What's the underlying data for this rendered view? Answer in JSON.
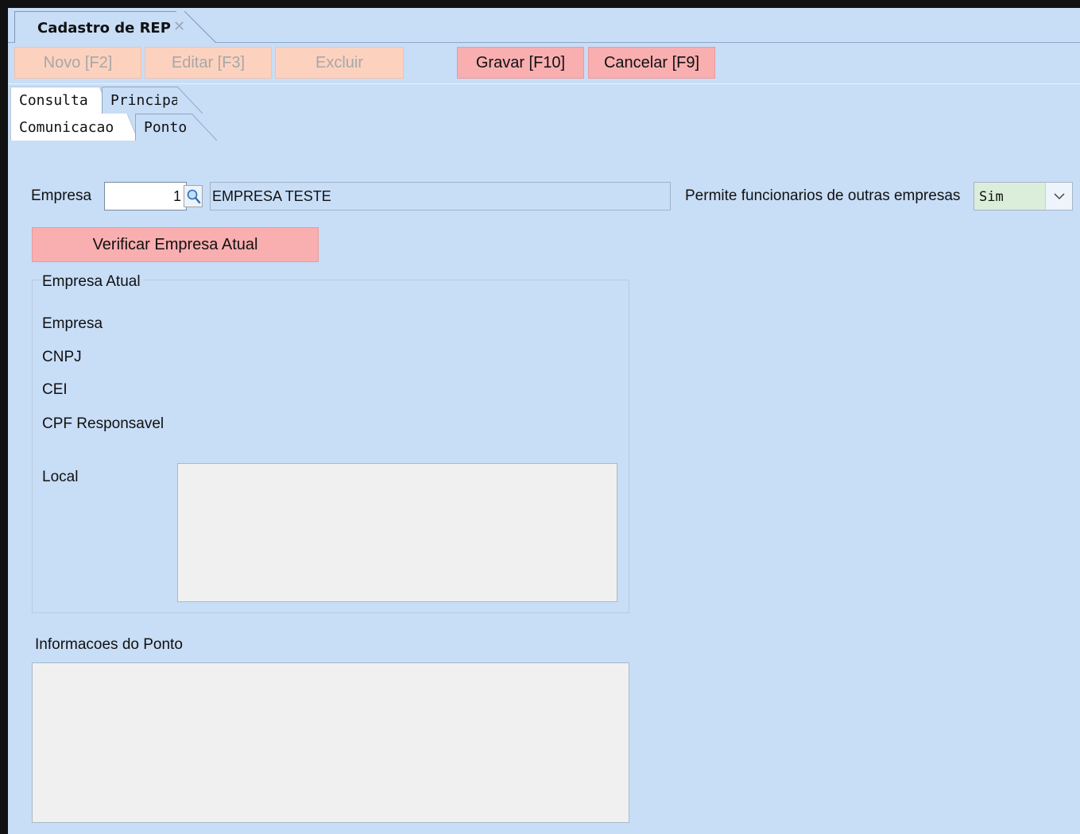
{
  "document_tab": {
    "title": "Cadastro de REP",
    "close_glyph": "✕"
  },
  "toolbar": {
    "novo_label": "Novo [F2]",
    "editar_label": "Editar [F3]",
    "excluir_label": "Excluir",
    "gravar_label": "Gravar [F10]",
    "cancelar_label": "Cancelar [F9]"
  },
  "page_tabs": {
    "consulta": "Consulta",
    "principal": "Principal",
    "comunicacao": "Comunicacao",
    "ponto": "Ponto"
  },
  "form": {
    "empresa_label": "Empresa",
    "empresa_code": "1",
    "empresa_name": "EMPRESA TESTE",
    "permite_label": "Permite funcionarios de outras empresas",
    "permite_value": "Sim",
    "verificar_button": "Verificar Empresa Atual"
  },
  "empresa_atual": {
    "group_title": "Empresa Atual",
    "empresa_label": "Empresa",
    "cnpj_label": "CNPJ",
    "cei_label": "CEI",
    "cpf_label": "CPF Responsavel",
    "local_label": "Local"
  },
  "informacoes": {
    "title": "Informacoes do Ponto"
  },
  "icons": {
    "lookup": "magnifier-icon",
    "close": "close-icon",
    "dropdown": "chevron-down-icon"
  }
}
